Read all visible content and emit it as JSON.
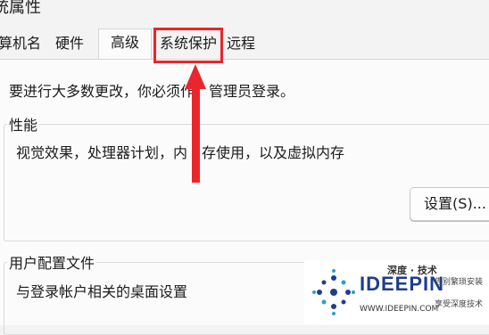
{
  "window": {
    "title": "统属性"
  },
  "tabs": [
    {
      "label": "算机名",
      "active": false
    },
    {
      "label": "硬件",
      "active": false
    },
    {
      "label": "高级",
      "active": true
    },
    {
      "label": "系统保护",
      "active": false,
      "highlighted": true
    },
    {
      "label": "远程",
      "active": false
    }
  ],
  "admin_note": "要进行大多数更改，你必须作",
  "admin_note_tail": "管理员登录。",
  "performance": {
    "label": "性能",
    "description": "视觉效果，处理器计划，内",
    "description_tail": "存使用，以及虚拟内存",
    "settings_button": "设置(S)..."
  },
  "user_profiles": {
    "label": "用户配置文件",
    "description": "与登录帐户相关的桌面设置"
  },
  "annotation": {
    "color": "#e8262c"
  },
  "watermark": {
    "cn_title": "深度 · 技术",
    "brand": "IDEEPIN",
    "url": "WWW.IDEEPIN.COM",
    "slogan1": "告别繁琐安装",
    "slogan2": "享受深度技术"
  }
}
